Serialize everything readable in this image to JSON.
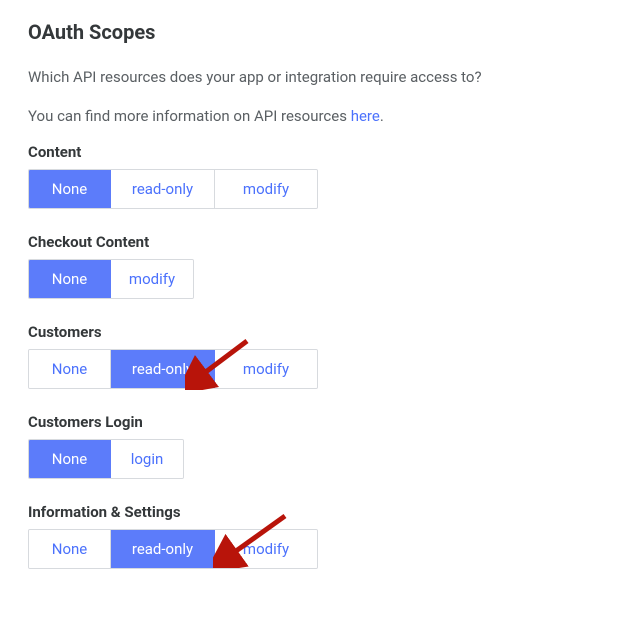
{
  "title": "OAuth Scopes",
  "description_1": "Which API resources does your app or integration require access to?",
  "description_2_prefix": "You can find more information on API resources ",
  "description_2_link": "here",
  "description_2_suffix": ".",
  "scopes": {
    "content": {
      "label": "Content",
      "options": {
        "none": "None",
        "read": "read-only",
        "modify": "modify"
      },
      "selected": "none"
    },
    "checkout_content": {
      "label": "Checkout Content",
      "options": {
        "none": "None",
        "modify": "modify"
      },
      "selected": "none"
    },
    "customers": {
      "label": "Customers",
      "options": {
        "none": "None",
        "read": "read-only",
        "modify": "modify"
      },
      "selected": "read"
    },
    "customers_login": {
      "label": "Customers Login",
      "options": {
        "none": "None",
        "login": "login"
      },
      "selected": "none"
    },
    "information_settings": {
      "label": "Information & Settings",
      "options": {
        "none": "None",
        "read": "read-only",
        "modify": "modify"
      },
      "selected": "read"
    }
  },
  "annotations": {
    "arrow_color": "#b8140a"
  }
}
